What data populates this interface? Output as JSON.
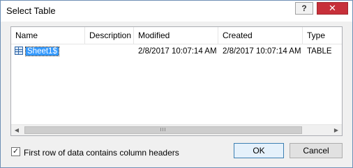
{
  "window": {
    "title": "Select Table",
    "help_label": "?",
    "close_label": "✕"
  },
  "table": {
    "columns": [
      "Name",
      "Description",
      "Modified",
      "Created",
      "Type"
    ],
    "rows": [
      {
        "name": "Sheet1$",
        "description": "",
        "modified": "2/8/2017 10:07:14 AM",
        "created": "2/8/2017 10:07:14 AM",
        "type": "TABLE",
        "selected": true
      }
    ]
  },
  "scrollbar": {
    "left_arrow": "◀",
    "right_arrow": "▶",
    "grip": "III"
  },
  "options": {
    "first_row_headers_label": "First row of data contains column headers",
    "first_row_headers_checked": true,
    "check_mark": "✓"
  },
  "buttons": {
    "ok": "OK",
    "cancel": "Cancel"
  },
  "icons": {
    "row_icon": "table-icon"
  }
}
